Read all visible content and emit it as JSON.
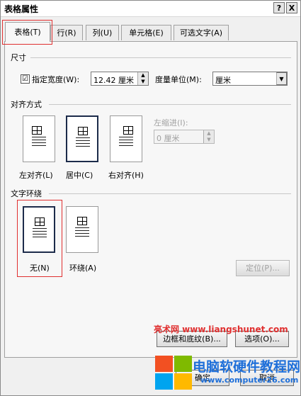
{
  "window": {
    "title": "表格属性",
    "help_label": "?",
    "close_label": "X"
  },
  "tabs": [
    {
      "label": "表格(T)",
      "active": true
    },
    {
      "label": "行(R)"
    },
    {
      "label": "列(U)"
    },
    {
      "label": "单元格(E)"
    },
    {
      "label": "可选文字(A)"
    }
  ],
  "size": {
    "section_label": "尺寸",
    "checked": true,
    "checkbox_mark": "☑",
    "preferred_width_label": "指定宽度(W):",
    "preferred_width_value": "12.42 厘米",
    "measure_label": "度量单位(M):",
    "measure_value": "厘米"
  },
  "alignment": {
    "section_label": "对齐方式",
    "left_label": "左对齐(L)",
    "center_label": "居中(C)",
    "right_label": "右对齐(H)",
    "selected": "center",
    "indent_label": "左缩进(I):",
    "indent_value": "0 厘米"
  },
  "wrapping": {
    "section_label": "文字环绕",
    "none_label": "无(N)",
    "around_label": "环绕(A)",
    "selected": "none",
    "positioning_label": "定位(P)..."
  },
  "buttons": {
    "borders_label": "边框和底纹(B)...",
    "options_label": "选项(O)...",
    "ok_label": "确定",
    "cancel_label": "取消"
  },
  "watermark": {
    "site_text": "亮术网 www.liangshunet.com",
    "brand_text": "电脑软硬件教程网",
    "brand_url": "www.computer26.com"
  },
  "colors": {
    "highlight_red": "#e03030",
    "brand_blue": "#1e6fd9"
  }
}
